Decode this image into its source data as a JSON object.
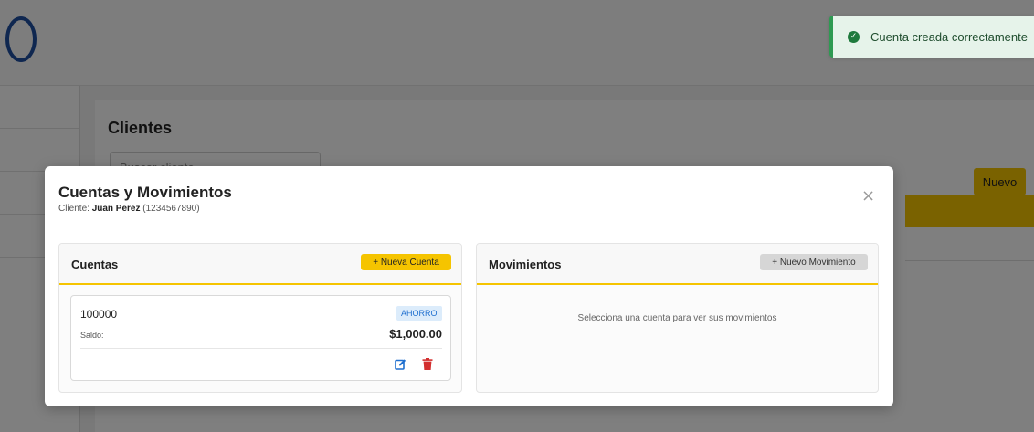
{
  "app": {
    "main_title": "Clientes",
    "search_placeholder": "Buscar cliente",
    "new_button": "Nuevo"
  },
  "toast": {
    "message": "Cuenta creada correctamente",
    "icon": "check-circle-icon",
    "close_glyph": "×",
    "color": "#2e9a52"
  },
  "modal": {
    "title": "Cuentas y Movimientos",
    "subtitle_prefix": "Cliente:",
    "client_name": "Juan Perez",
    "client_id": "(1234567890)",
    "close_glyph": "×",
    "accounts_panel": {
      "title": "Cuentas",
      "new_button": "+ Nueva Cuenta",
      "accounts": [
        {
          "number": "100000",
          "type": "AHORRO",
          "balance_label": "Saldo:",
          "balance": "$1,000.00"
        }
      ]
    },
    "movements_panel": {
      "title": "Movimientos",
      "new_button": "+ Nuevo Movimiento",
      "empty_message": "Selecciona una cuenta para ver sus movimientos"
    }
  },
  "colors": {
    "accent": "#f5c400",
    "danger": "#d32f2f",
    "edit": "#1f6fcf"
  }
}
